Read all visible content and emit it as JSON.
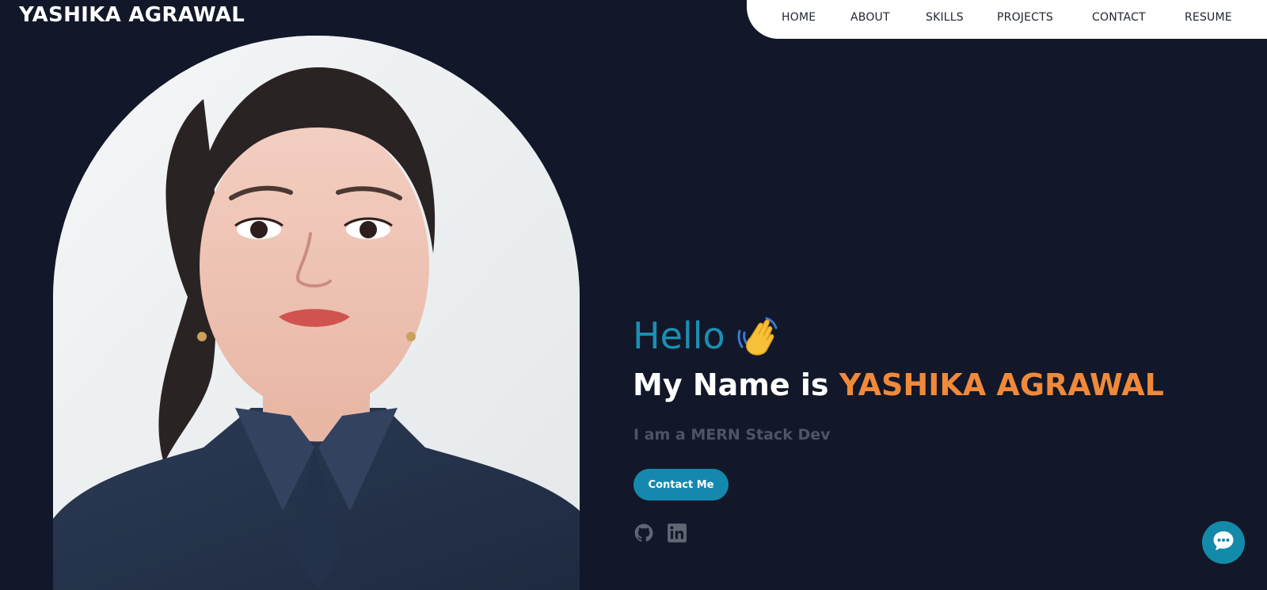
{
  "header": {
    "logo": "YASHIKA AGRAWAL",
    "nav": [
      {
        "label": "HOME"
      },
      {
        "label": "ABOUT"
      },
      {
        "label": "SKILLS"
      },
      {
        "label": "PROJECTS"
      },
      {
        "label": "CONTACT"
      },
      {
        "label": "RESUME"
      }
    ]
  },
  "hero": {
    "greeting": "Hello",
    "greeting_icon": "waving-hand-icon",
    "intro_prefix": "My Name is",
    "name": "YASHIKA AGRAWAL",
    "tagline": "I am a MERN Stack Dev",
    "contact_button": "Contact Me",
    "socials": [
      {
        "icon": "github-icon"
      },
      {
        "icon": "linkedin-icon"
      }
    ]
  },
  "chat": {
    "icon": "chat-bubble-icon"
  },
  "colors": {
    "background": "#121829",
    "accent_blue": "#1589ad",
    "accent_orange": "#f0893a",
    "muted_text": "#4d5565",
    "nav_background": "#ffffff"
  }
}
